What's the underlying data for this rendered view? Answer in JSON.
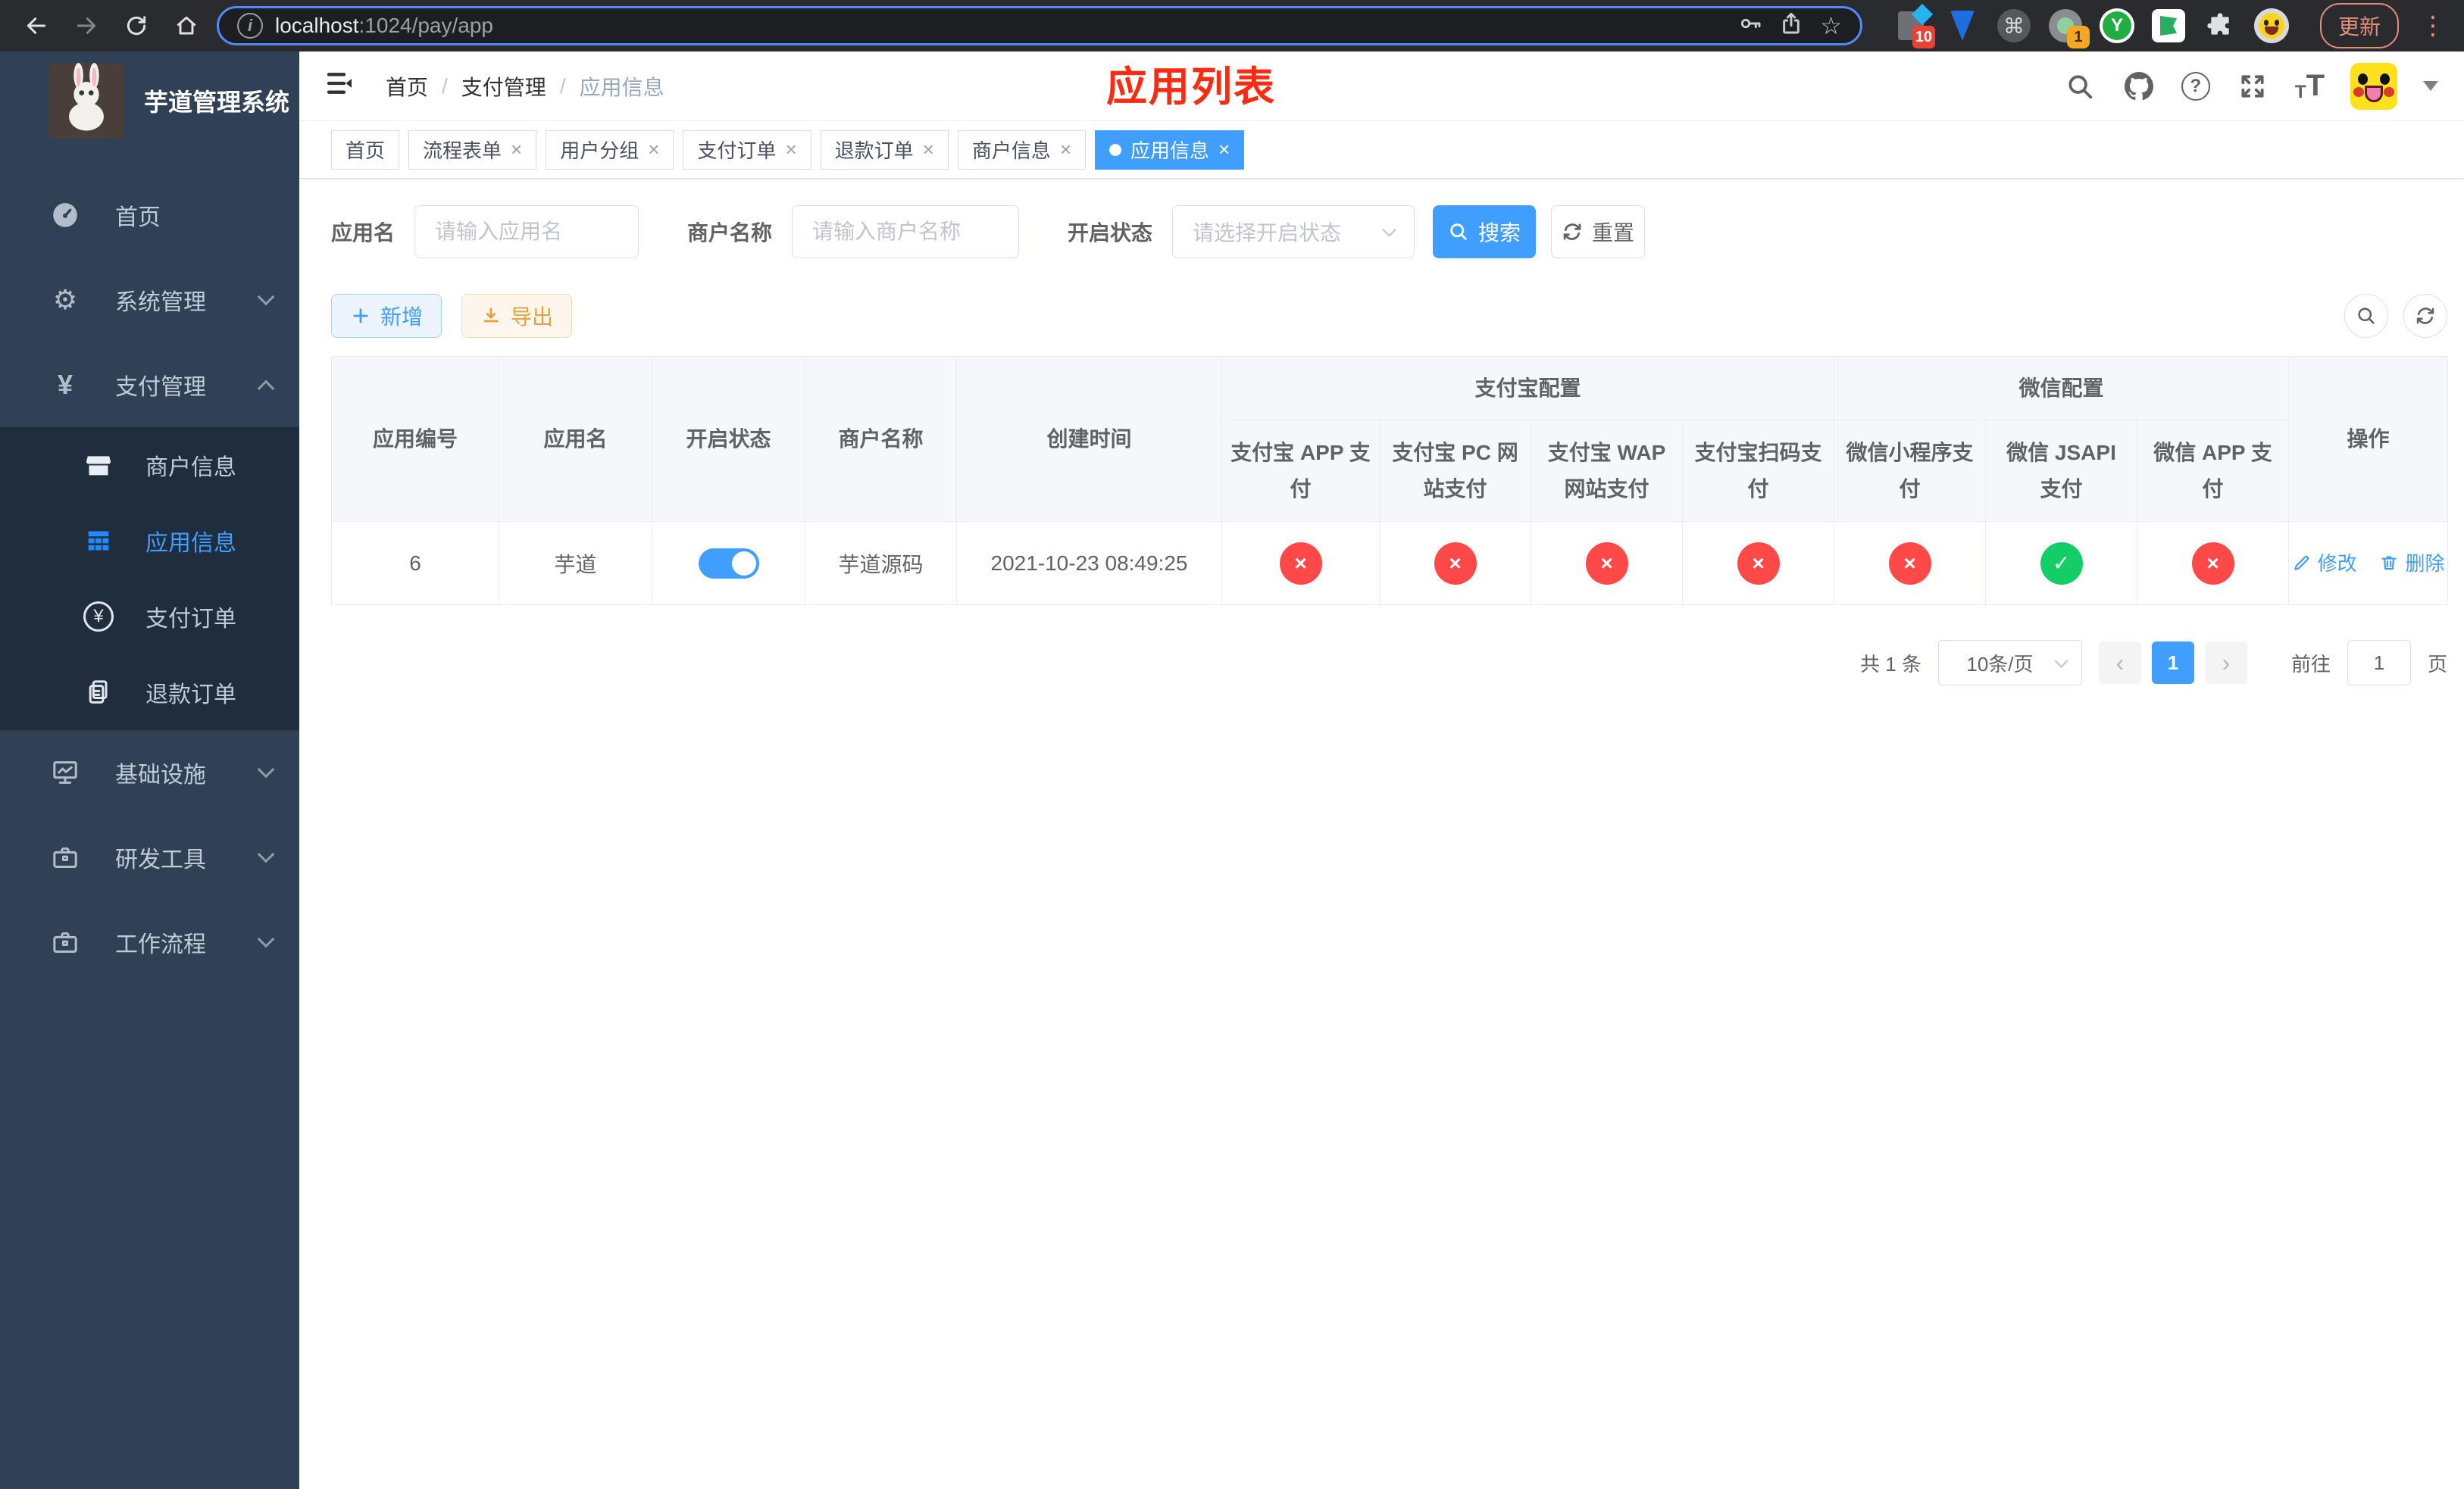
{
  "colors": {
    "accent": "#409eff",
    "success": "#13ce66",
    "danger": "#ff4949",
    "annotation_red": "#fb2b12",
    "sidebar_bg": "#304156",
    "submenu_bg": "#1f2d3d"
  },
  "icons": {
    "info_letter": "i",
    "star": "☆",
    "cmd": "⌘",
    "kebab": "⋮",
    "question": "?",
    "font_small": "T",
    "font_large": "T",
    "gear": "⚙",
    "yen": "¥",
    "avatar_y": "Y",
    "check": "✓",
    "cross": "×",
    "prev": "‹",
    "next": "›"
  },
  "browser": {
    "url_host": "localhost",
    "url_rest": ":1024/pay/app",
    "update_label": "更新",
    "ext_badge_1": "10",
    "ext_badge_2": "1"
  },
  "sidebar": {
    "title": "芋道管理系统",
    "items": [
      {
        "label": "首页"
      },
      {
        "label": "系统管理"
      },
      {
        "label": "支付管理"
      },
      {
        "label": "基础设施"
      },
      {
        "label": "研发工具"
      },
      {
        "label": "工作流程"
      }
    ],
    "submenu": [
      {
        "label": "商户信息"
      },
      {
        "label": "应用信息"
      },
      {
        "label": "支付订单"
      },
      {
        "label": "退款订单"
      }
    ]
  },
  "header": {
    "breadcrumb": [
      "首页",
      "支付管理",
      "应用信息"
    ],
    "separator": "/",
    "annotation": "应用列表"
  },
  "tabs": [
    {
      "label": "首页"
    },
    {
      "label": "流程表单"
    },
    {
      "label": "用户分组"
    },
    {
      "label": "支付订单"
    },
    {
      "label": "退款订单"
    },
    {
      "label": "商户信息"
    },
    {
      "label": "应用信息"
    }
  ],
  "filters": {
    "app_name_label": "应用名",
    "app_name_placeholder": "请输入应用名",
    "merchant_label": "商户名称",
    "merchant_placeholder": "请输入商户名称",
    "status_label": "开启状态",
    "status_placeholder": "请选择开启状态",
    "search_label": "搜索",
    "reset_label": "重置"
  },
  "toolbar": {
    "add_label": "新增",
    "export_label": "导出"
  },
  "table": {
    "col_id": "应用编号",
    "col_name": "应用名",
    "col_status": "开启状态",
    "col_merchant": "商户名称",
    "col_created": "创建时间",
    "group_alipay": "支付宝配置",
    "group_wechat": "微信配置",
    "sub_columns": [
      "支付宝 APP 支付",
      "支付宝 PC 网站支付",
      "支付宝 WAP 网站支付",
      "支付宝扫码支付",
      "微信小程序支付",
      "微信 JSAPI 支付",
      "微信 APP 支付"
    ],
    "col_actions": "操作",
    "row": {
      "id": "6",
      "name": "芋道",
      "enabled": true,
      "merchant": "芋道源码",
      "created": "2021-10-23 08:49:25",
      "statuses": [
        false,
        false,
        false,
        false,
        false,
        true,
        false
      ],
      "edit_label": "修改",
      "delete_label": "删除"
    }
  },
  "pagination": {
    "total": "共 1 条",
    "page_size": "10条/页",
    "page": "1",
    "goto_label": "前往",
    "goto_value": "1",
    "unit": "页"
  }
}
